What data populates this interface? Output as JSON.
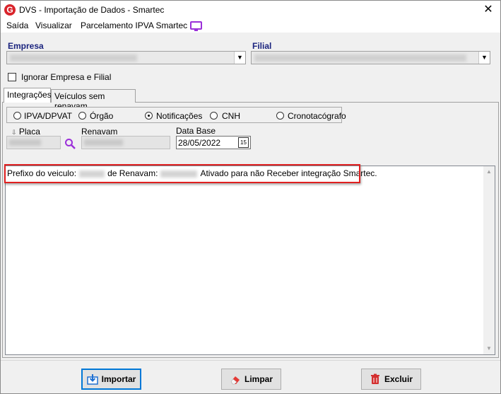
{
  "window": {
    "title": "DVS - Importação de Dados - Smartec",
    "close_glyph": "✕"
  },
  "menu": {
    "items": [
      "Saída",
      "Visualizar",
      "Parcelamento IPVA Smartec"
    ],
    "icon": "tv-icon"
  },
  "empresa": {
    "label": "Empresa"
  },
  "filial": {
    "label": "Filial"
  },
  "ignorar_checkbox": {
    "label": "Ignorar Empresa e Filial",
    "checked": false
  },
  "tabs": [
    {
      "label": "Integrações",
      "active": true
    },
    {
      "label": "Veículos sem renavam",
      "active": false
    }
  ],
  "radio_options": [
    {
      "label": "IPVA/DPVAT",
      "checked": false
    },
    {
      "label": "Órgão",
      "checked": false
    },
    {
      "label": "Notificações",
      "checked": true
    },
    {
      "label": "CNH",
      "checked": false
    },
    {
      "label": "Cronotacógrafo",
      "checked": false
    }
  ],
  "fields": {
    "placa_label": "Placa",
    "renavam_label": "Renavam",
    "data_base_label": "Data Base",
    "data_base_value": "28/05/2022",
    "calendar_glyph": "15"
  },
  "log": {
    "part1": "Prefixo do veiculo:",
    "part2": "de Renavam:",
    "part3": "Ativado para não Receber integração Smartec."
  },
  "buttons": {
    "importar": "Importar",
    "limpar": "Limpar",
    "excluir": "Excluir"
  },
  "colors": {
    "highlight": "#e02020",
    "label_blue": "#1a237e",
    "icon_purple": "#9b30d9"
  }
}
